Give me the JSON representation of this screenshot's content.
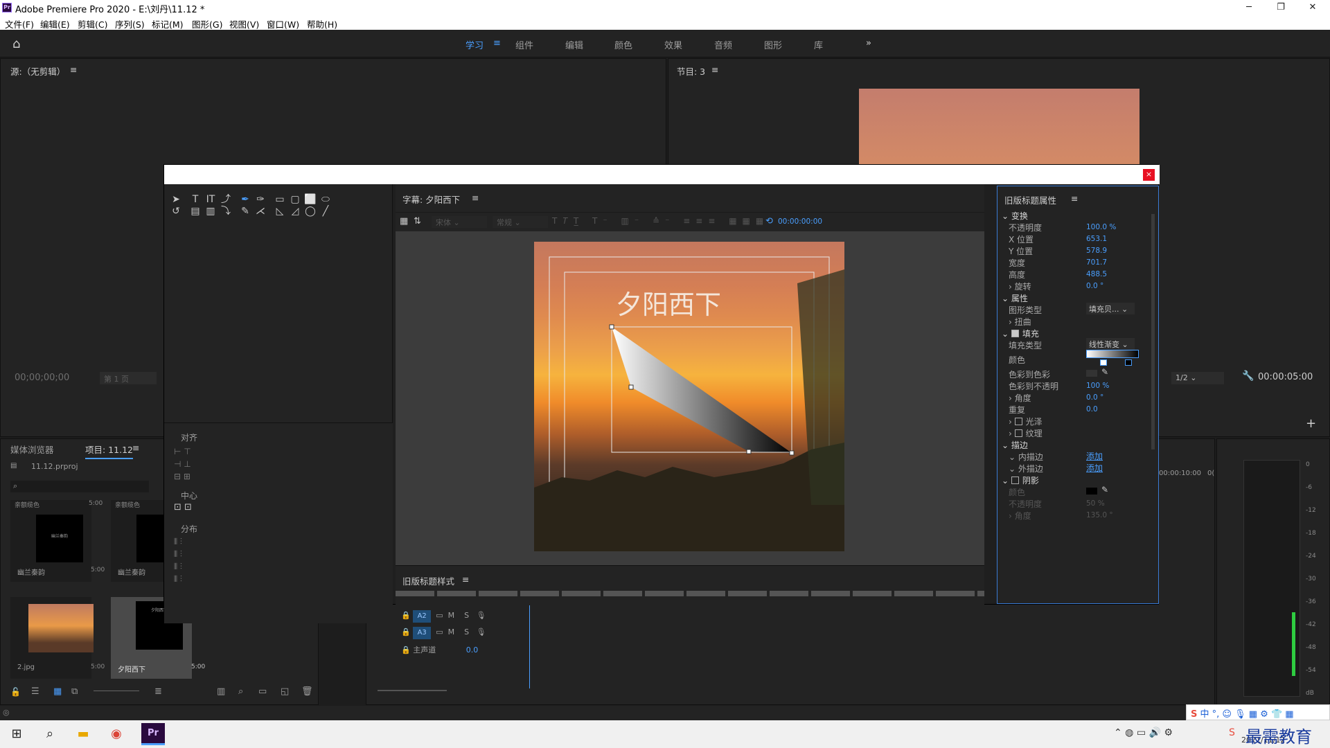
{
  "app": {
    "logo": "Pr",
    "title": "Adobe Premiere Pro 2020 - E:\\刘丹\\11.12 *"
  },
  "menu": [
    "文件(F)",
    "编辑(E)",
    "剪辑(C)",
    "序列(S)",
    "标记(M)",
    "图形(G)",
    "视图(V)",
    "窗口(W)",
    "帮助(H)"
  ],
  "workspaces": [
    "学习",
    "组件",
    "编辑",
    "颜色",
    "效果",
    "音频",
    "图形",
    "库"
  ],
  "workspace_more": "»",
  "source_panel": {
    "title": "源:（无剪辑）",
    "timecode": "00;00;00;00",
    "page": "第 1 页"
  },
  "program_panel": {
    "title": "节目: 3",
    "zoom": "1/2",
    "timecode": "00:00:05:00"
  },
  "project_panel": {
    "tabs": [
      "媒体浏览器",
      "项目: 11.12"
    ],
    "file": "11.12.prproj",
    "items": [
      {
        "name": "幽兰秦韵",
        "duration": "5:00",
        "header": "亲额缆色",
        "header_dur": "5:00",
        "mini": "幽兰秦韵"
      },
      {
        "name": "幽兰秦韵",
        "duration": "",
        "header": "亲额缆色",
        "header_dur": ""
      },
      {
        "name": "2.jpg",
        "duration": "5:00"
      },
      {
        "name": "夕阳西下",
        "duration": "5:00",
        "mini": "夕阳西下"
      }
    ]
  },
  "titler": {
    "window_close": "×",
    "tab_title": "字幕: 夕阳西下",
    "font_family": "宋体",
    "font_style": "常规",
    "time": "00:00:00:00",
    "canvas_text": "夕阳西下",
    "styles_title": "旧版标题样式",
    "align_labels": [
      "对齐",
      "中心",
      "分布"
    ]
  },
  "properties": {
    "panel_title": "旧版标题属性",
    "transform": {
      "label": "变换",
      "rows": [
        {
          "label": "不透明度",
          "value": "100.0 %"
        },
        {
          "label": "X 位置",
          "value": "653.1"
        },
        {
          "label": "Y 位置",
          "value": "578.9"
        },
        {
          "label": "宽度",
          "value": "701.7"
        },
        {
          "label": "高度",
          "value": "488.5"
        },
        {
          "label": "旋转",
          "value": "0.0 °"
        }
      ]
    },
    "attributes": {
      "label": "属性",
      "shape_type_label": "图形类型",
      "shape_type": "填充贝...",
      "distort": "扭曲"
    },
    "fill": {
      "label": "填充",
      "fill_type_label": "填充类型",
      "fill_type": "线性渐变",
      "color_label": "颜色",
      "color_to_color": "色彩到色彩",
      "color_to_opacity_label": "色彩到不透明",
      "color_to_opacity": "100 %",
      "angle_label": "角度",
      "angle": "0.0 °",
      "repeat_label": "重复",
      "repeat": "0.0",
      "sheen": "光泽",
      "texture": "纹理"
    },
    "stroke": {
      "label": "描边",
      "inner": "内描边",
      "outer": "外描边",
      "add": "添加"
    },
    "shadow": {
      "label": "阴影",
      "color_label": "颜色",
      "opacity_label": "不透明度",
      "opacity": "50 %",
      "angle_label": "角度",
      "angle": "135.0 °"
    }
  },
  "timeline": {
    "tracks": [
      {
        "name": "A2",
        "m": "M",
        "s": "S"
      },
      {
        "name": "A3",
        "m": "M",
        "s": "S"
      }
    ],
    "master_label": "主声道",
    "master_value": "0.0",
    "ruler_time": "00:00:10:00",
    "ruler_end": "0("
  },
  "audio_meter": {
    "scale": [
      "0",
      "-6",
      "-12",
      "-18",
      "-24",
      "-30",
      "-36",
      "-42",
      "-48",
      "-54",
      "dB"
    ]
  },
  "taskbar": {
    "time": "",
    "date": "2021/11/12",
    "watermark": "最需教育",
    "ime": "中"
  },
  "colors": {
    "accent": "#4a9fff",
    "close": "#e81123",
    "panel": "#232323"
  }
}
